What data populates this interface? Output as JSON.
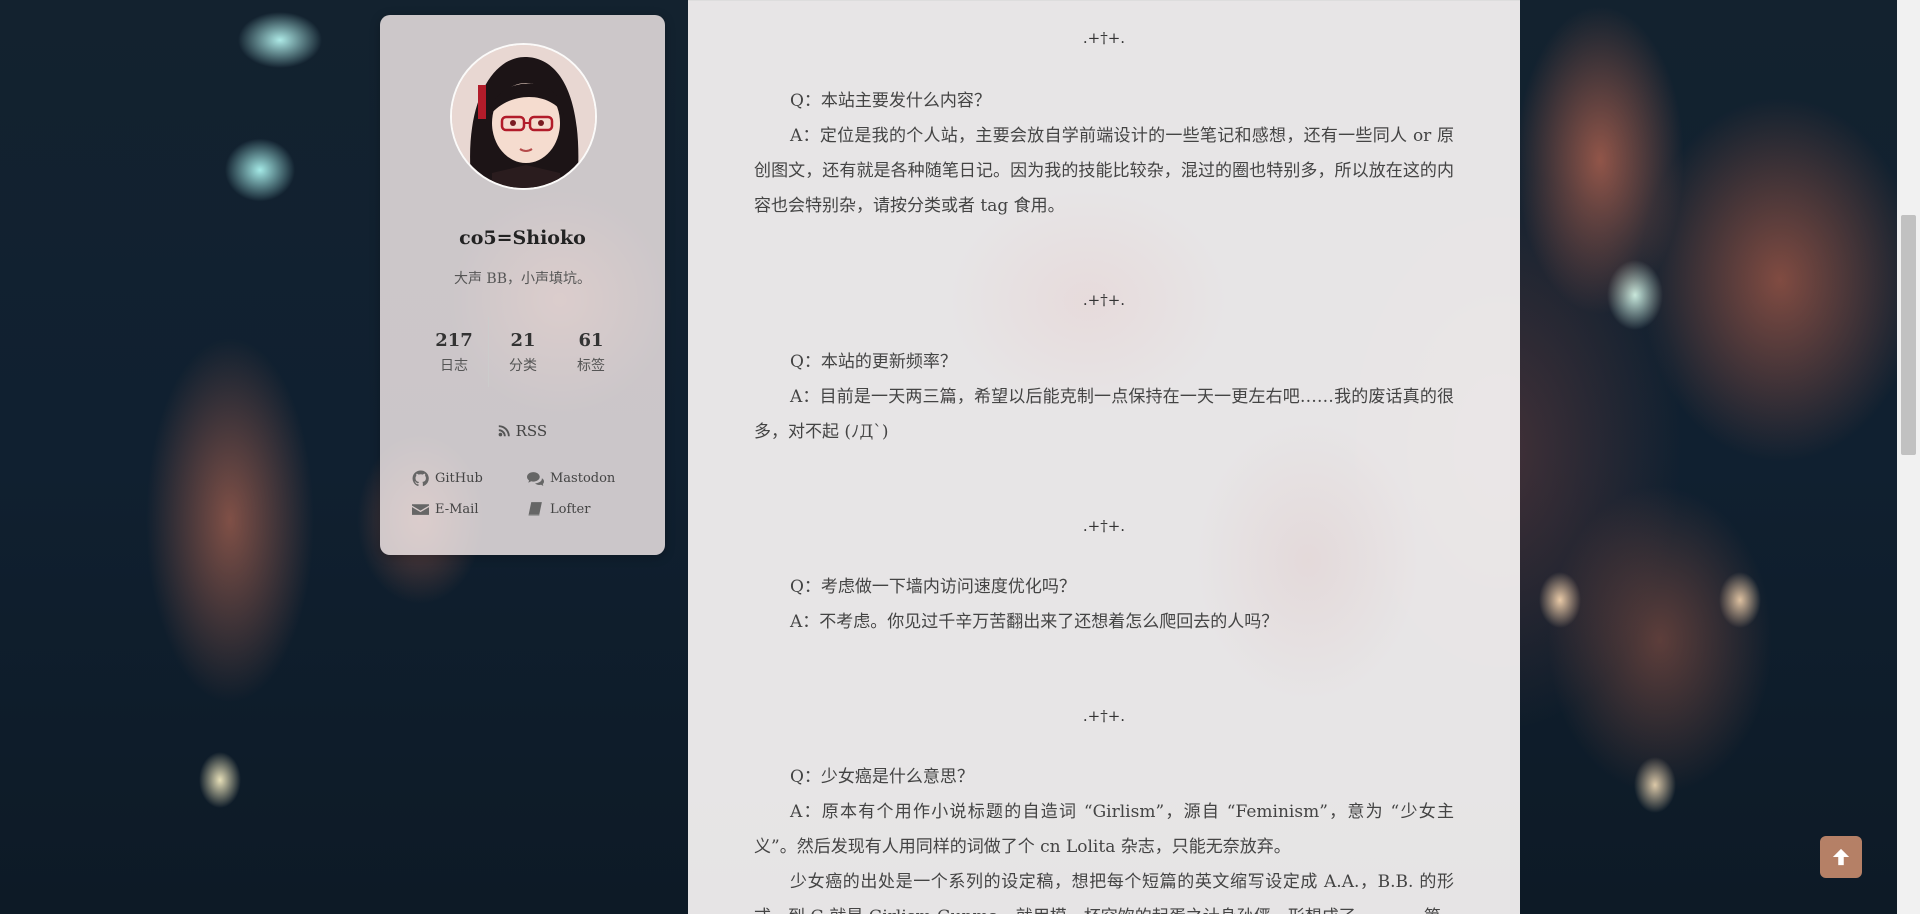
{
  "sidebar": {
    "author_name": "co5=Shioko",
    "author_desc": "大声 BB，小声填坑。",
    "stats": [
      {
        "count": "217",
        "label": "日志"
      },
      {
        "count": "21",
        "label": "分类"
      },
      {
        "count": "61",
        "label": "标签"
      }
    ],
    "rss_label": "RSS",
    "links": [
      {
        "label": "GitHub",
        "icon": "github-icon"
      },
      {
        "label": "Mastodon",
        "icon": "comments-icon"
      },
      {
        "label": "E-Mail",
        "icon": "envelope-icon"
      },
      {
        "label": "Lofter",
        "icon": "book-icon"
      }
    ]
  },
  "post": {
    "separator": ".+†+.",
    "paragraphs": [
      "Q：本站主要发什么内容？",
      "A：定位是我的个人站，主要会放自学前端设计的一些笔记和感想，还有一些同人 or 原创图文，还有就是各种随笔日记。因为我的技能比较杂，混过的圈也特别多，所以放在这的内容也会特别杂，请按分类或者 tag 食用。",
      "Q：本站的更新频率？",
      "A：目前是一天两三篇，希望以后能克制一点保持在一天一更左右吧……我的废话真的很多，对不起 (ﾉД`)",
      "Q：考虑做一下墙内访问速度优化吗？",
      "A：不考虑。你见过千辛万苦翻出来了还想着怎么爬回去的人吗？",
      "Q：少女癌是什么意思？",
      "A：原本有个用作小说标题的自造词 “Girlism”，源自 “Feminism”，意为 “少女主义”。然后发现有人用同样的词做了个 cn Lolita 杂志，只能无奈放弃。",
      "少女癌的出处是一个系列的设定稿，想把每个短篇的英文缩写设定成 A.A.，B.B. 的形式，到 G 就是 Girlism Gunma，就用模一杯空饮的起蛋之计身孙俨，形想成了…………第"
    ]
  },
  "colors": {
    "back_to_top": "#c88c6e"
  }
}
